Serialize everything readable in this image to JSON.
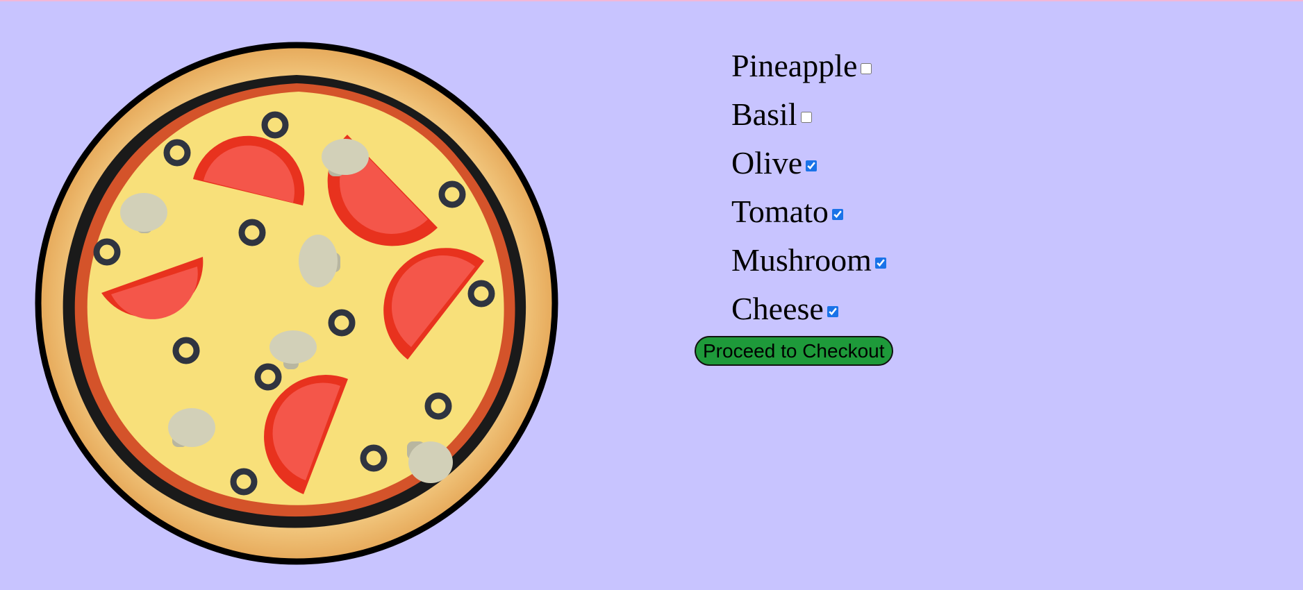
{
  "toppings": [
    {
      "label": "Pineapple",
      "checked": false
    },
    {
      "label": "Basil",
      "checked": false
    },
    {
      "label": "Olive",
      "checked": true
    },
    {
      "label": "Tomato",
      "checked": true
    },
    {
      "label": "Mushroom",
      "checked": true
    },
    {
      "label": "Cheese",
      "checked": true
    }
  ],
  "checkout": {
    "label": "Proceed to Checkout"
  },
  "colors": {
    "background": "#c8c4ff",
    "crust": "#f0c27a",
    "sauce": "#d4532a",
    "cheese": "#f8e07a",
    "tomato": "#e8321e",
    "olive": "#2f3440",
    "mushroom": "#d2d0b8",
    "button": "#1e9a3a",
    "checkbox": "#1a73e8"
  },
  "icons": {
    "pizza": "pizza-icon"
  }
}
